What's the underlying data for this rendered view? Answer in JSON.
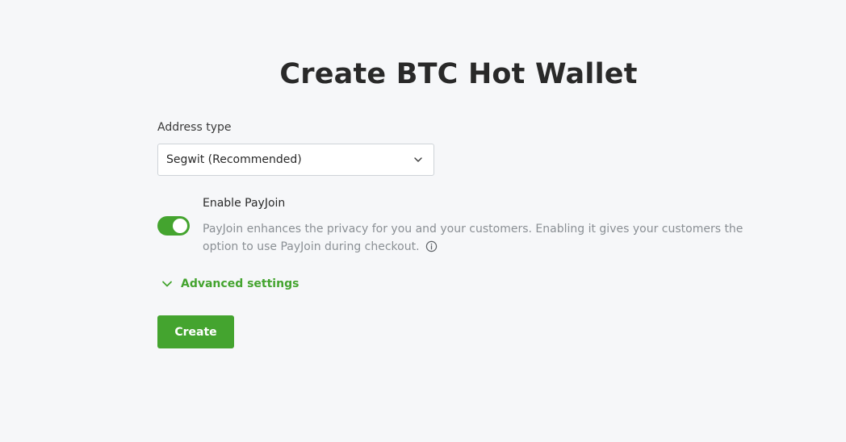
{
  "page": {
    "title": "Create BTC Hot Wallet"
  },
  "address_type": {
    "label": "Address type",
    "selected": "Segwit (Recommended)",
    "icon": "chevron-down-icon"
  },
  "payjoin": {
    "label": "Enable PayJoin",
    "enabled": true,
    "description": "PayJoin enhances the privacy for you and your customers. Enabling it gives your customers the option to use PayJoin during checkout.",
    "info_icon": "info-icon"
  },
  "advanced": {
    "label": "Advanced settings",
    "icon": "chevron-down-icon"
  },
  "actions": {
    "create_label": "Create"
  },
  "colors": {
    "accent": "#44a42f",
    "background": "#f6f7f9",
    "text": "#292929",
    "muted": "#8a8f94",
    "border": "#ced3d8"
  }
}
